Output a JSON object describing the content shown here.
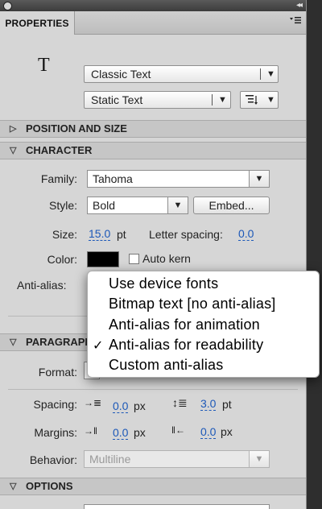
{
  "window": {
    "collapse_glyph": "◂◂"
  },
  "tab": {
    "label": "PROPERTIES"
  },
  "panel_menu_icon": "panel-menu-icon",
  "tool_icon": "T",
  "text_type": {
    "value": "Classic Text"
  },
  "text_mode": {
    "value": "Static Text"
  },
  "sections": {
    "position_size": "POSITION AND SIZE",
    "character": "CHARACTER",
    "paragraph": "PARAGRAPH",
    "options": "OPTIONS"
  },
  "character": {
    "family_label": "Family:",
    "family_value": "Tahoma",
    "style_label": "Style:",
    "style_value": "Bold",
    "embed_label": "Embed...",
    "size_label": "Size:",
    "size_value": "15.0",
    "size_unit": "pt",
    "letter_spacing_label": "Letter spacing:",
    "letter_spacing_value": "0.0",
    "color_label": "Color:",
    "color_value": "#000000",
    "auto_kern_label": "Auto kern",
    "anti_alias_label": "Anti-alias:"
  },
  "antialias_menu": {
    "items": [
      "Use device fonts",
      "Bitmap text [no anti-alias]",
      "Anti-alias for animation",
      "Anti-alias for readability",
      "Custom anti-alias"
    ],
    "selected_index": 3,
    "check_glyph": "✓"
  },
  "paragraph": {
    "format_label": "Format:",
    "spacing_label": "Spacing:",
    "indent_value": "0.0",
    "indent_unit": "px",
    "line_spacing_value": "3.0",
    "line_spacing_unit": "pt",
    "margins_label": "Margins:",
    "left_margin_value": "0.0",
    "left_margin_unit": "px",
    "right_margin_value": "0.0",
    "right_margin_unit": "px",
    "behavior_label": "Behavior:",
    "behavior_value": "Multiline"
  },
  "colors": {
    "panel_bg": "#d6d6d6",
    "link_blue": "#1c58b8"
  }
}
